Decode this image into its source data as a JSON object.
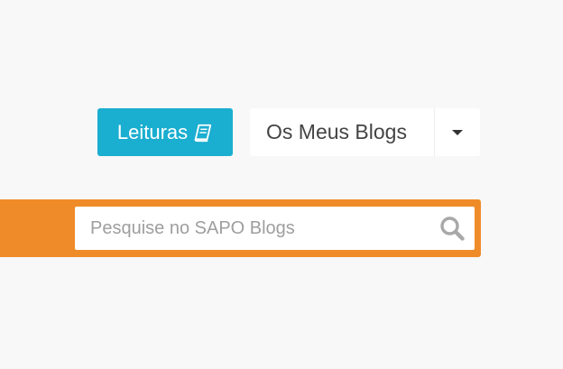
{
  "header": {
    "leituras_button": {
      "label": "Leituras",
      "icon": "book-icon",
      "color": "#1aaed0"
    },
    "blogs_button": {
      "label": "Os Meus Blogs",
      "caret_icon": "caret-down-icon"
    }
  },
  "search": {
    "placeholder": "Pesquise no SAPO Blogs",
    "value": "",
    "icon": "search-icon",
    "bar_color": "#f08b29"
  }
}
